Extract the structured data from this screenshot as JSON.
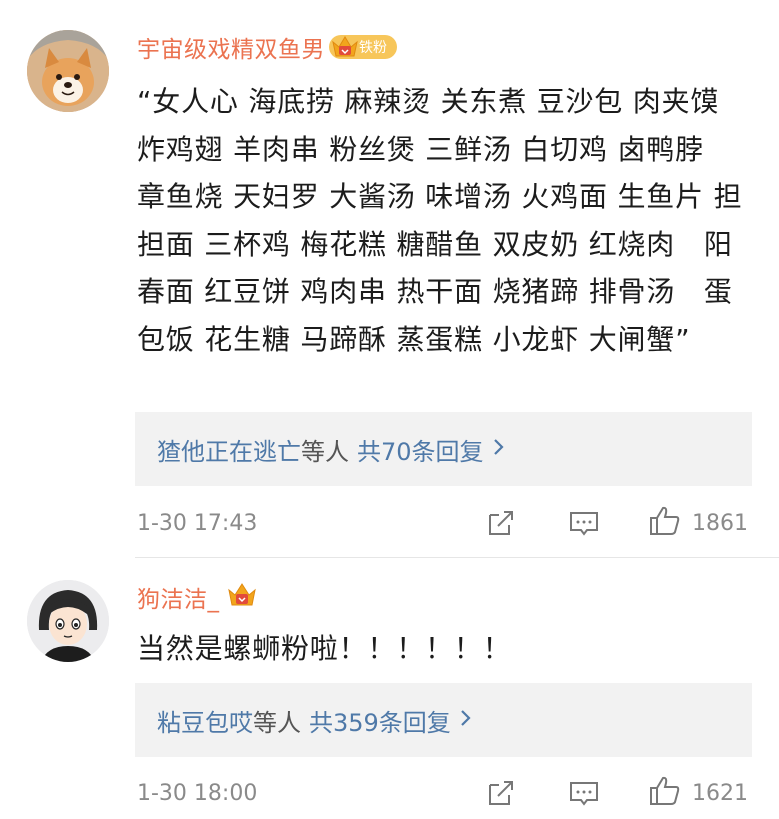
{
  "comments": [
    {
      "username": "宇宙级戏精双鱼男",
      "fan_badge": "铁粉",
      "text": "“女人心 海底捞 麻辣烫 关东煮 豆沙包 肉夹馍 炸鸡翅 羊肉串 粉丝煲 三鲜汤 白切鸡 卤鸭脖　章鱼烧 天妇罗 大酱汤 味增汤 火鸡面 生鱼片 担担面 三杯鸡 梅花糕 糖醋鱼 双皮奶 红烧肉　阳春面 红豆饼 鸡肉串 热干面 烧猪蹄 排骨汤　蛋包饭 花生糖 马蹄酥 蒸蛋糕 小龙虾 大闸蟹”",
      "reply_user": "猹他正在逃亡",
      "reply_mid": "等人",
      "reply_count": "共70条回复",
      "time": "1-30 17:43",
      "likes": "1861",
      "avatar_icon": "shiba-dog-avatar"
    },
    {
      "username": "狗洁洁_",
      "text": "当然是螺蛳粉啦！！！！！！",
      "reply_user": "粘豆包哎",
      "reply_mid": "等人",
      "reply_count": "共359条回复",
      "time": "1-30 18:00",
      "likes": "1621",
      "avatar_icon": "cartoon-girl-avatar"
    }
  ],
  "colors": {
    "username": "#eb7350",
    "reply_link": "#4f79a8",
    "meta_text": "#8a8a8a",
    "reply_bg": "#f2f2f2",
    "badge_gold": "#f7c65a"
  }
}
